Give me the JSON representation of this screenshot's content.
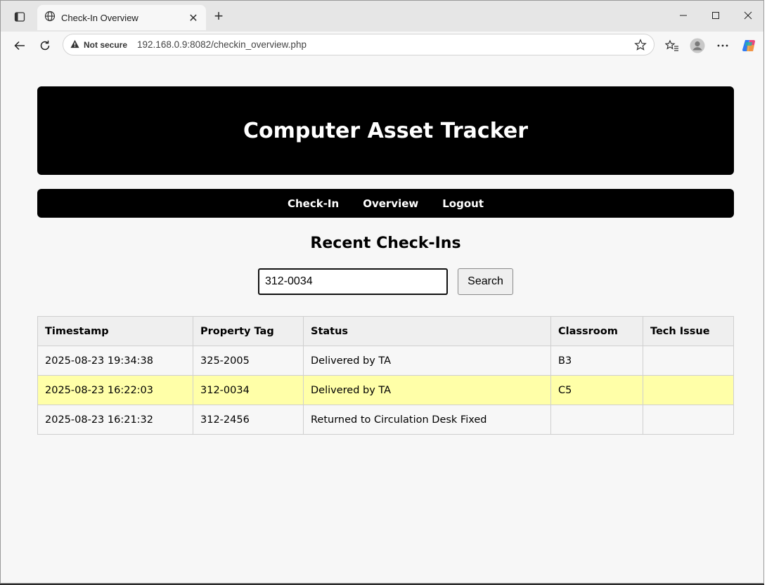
{
  "browser": {
    "tab_title": "Check-In Overview",
    "security_label": "Not secure",
    "url": "192.168.0.9:8082/checkin_overview.php"
  },
  "header": {
    "title": "Computer Asset Tracker"
  },
  "nav": {
    "links": [
      "Check-In",
      "Overview",
      "Logout"
    ]
  },
  "main": {
    "section_title": "Recent Check-Ins",
    "search": {
      "value": "312-0034",
      "button_label": "Search"
    },
    "table": {
      "headers": [
        "Timestamp",
        "Property Tag",
        "Status",
        "Classroom",
        "Tech Issue"
      ],
      "rows": [
        [
          "2025-08-23 19:34:38",
          "325-2005",
          "Delivered by TA",
          "B3",
          ""
        ],
        [
          "2025-08-23 16:22:03",
          "312-0034",
          "Delivered by TA",
          "C5",
          ""
        ],
        [
          "2025-08-23 16:21:32",
          "312-2456",
          "Returned to Circulation Desk Fixed",
          "",
          ""
        ]
      ],
      "highlight_row": 1,
      "highlight_color": "#ffffa8"
    }
  }
}
